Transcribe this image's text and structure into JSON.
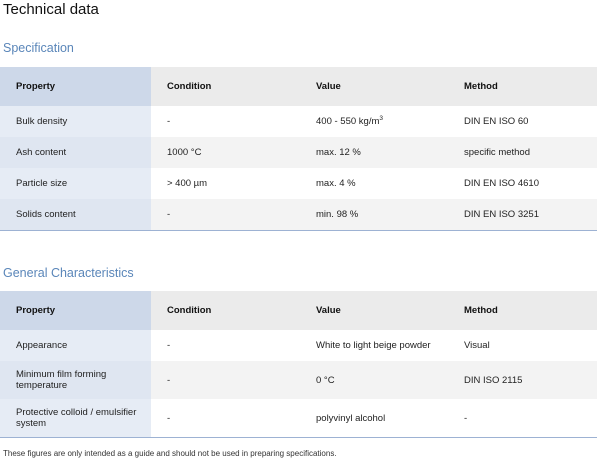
{
  "page_title": "Technical data",
  "specification": {
    "title": "Specification",
    "headers": [
      "Property",
      "Condition",
      "Value",
      "Method"
    ],
    "rows": [
      [
        "Bulk density",
        "-",
        "400 - 550 kg/m",
        "DIN EN ISO 60"
      ],
      [
        "Ash content",
        "1000 °C",
        "max. 12 %",
        "specific method"
      ],
      [
        "Particle size",
        "> 400 µm",
        "max. 4 %",
        "DIN EN ISO 4610"
      ],
      [
        "Solids content",
        "-",
        "min. 98 %",
        "DIN EN ISO 3251"
      ]
    ],
    "bulk_density_exponent": "3"
  },
  "general": {
    "title": "General Characteristics",
    "headers": [
      "Property",
      "Condition",
      "Value",
      "Method"
    ],
    "rows": [
      [
        "Appearance",
        "-",
        "White to light beige powder",
        "Visual"
      ],
      [
        "Minimum film forming temperature",
        "-",
        "0 °C",
        "DIN ISO 2115"
      ],
      [
        "Protective colloid / emulsifier system",
        "-",
        "polyvinyl alcohol",
        "-"
      ]
    ]
  },
  "footnote": "These figures are only intended as a guide and should not be used in preparing specifications."
}
